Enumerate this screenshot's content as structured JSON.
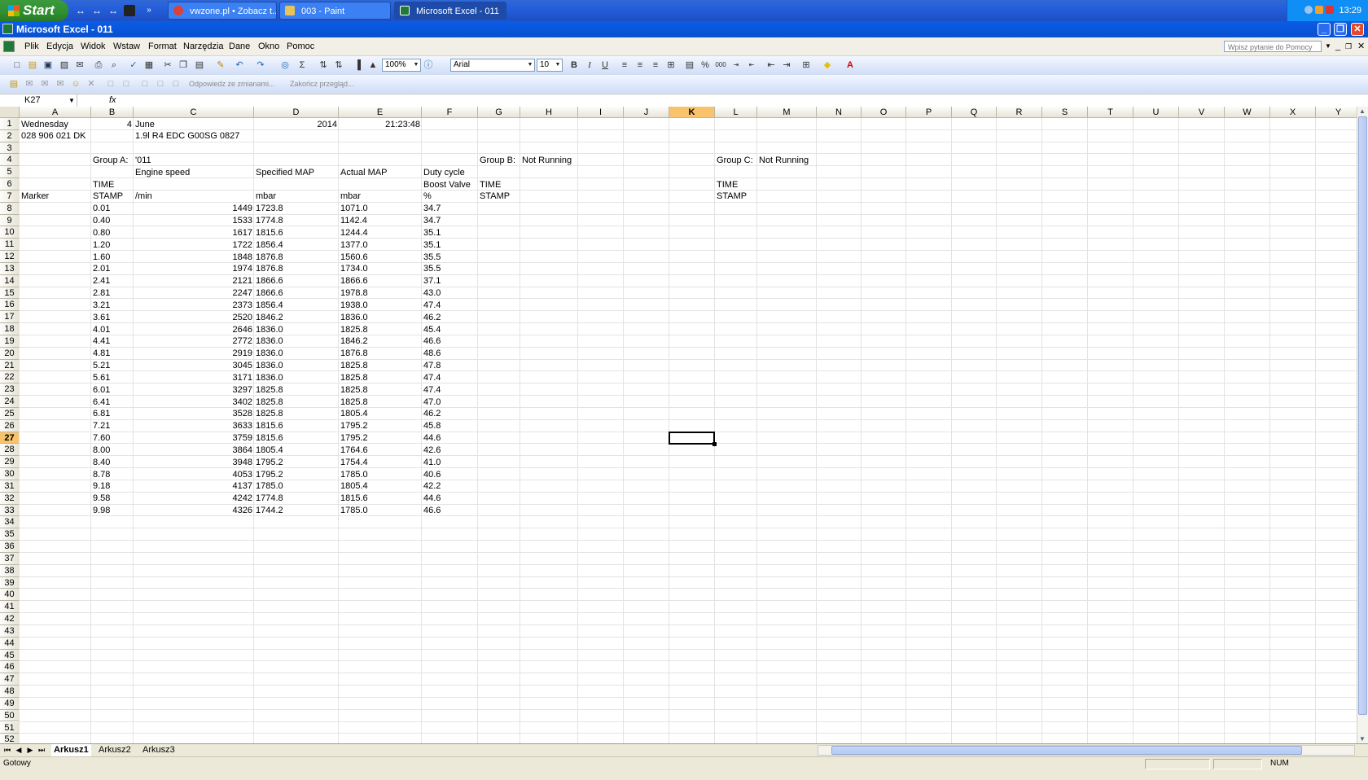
{
  "taskbar": {
    "start_label": "Start",
    "tasks": [
      {
        "label": "vwzone.pl • Zobacz t...",
        "active": false
      },
      {
        "label": "003 - Paint",
        "active": false
      },
      {
        "label": "Microsoft Excel - 011",
        "active": true
      }
    ],
    "clock": "13:29"
  },
  "window": {
    "title": "Microsoft Excel - 011"
  },
  "menu": {
    "items": [
      "Plik",
      "Edycja",
      "Widok",
      "Wstaw",
      "Format",
      "Narzędzia",
      "Dane",
      "Okno",
      "Pomoc"
    ],
    "help_placeholder": "Wpisz pytanie do Pomocy"
  },
  "toolbar": {
    "zoom": "100%",
    "font": "Arial",
    "font_size": "10",
    "bold": "B",
    "italic": "I",
    "underline": "U",
    "review_reply": "Odpowiedz ze zmianami...",
    "review_end": "Zakończ przegląd..."
  },
  "formula_bar": {
    "name_box": "K27",
    "fx": "fx",
    "content": ""
  },
  "sheet": {
    "columns": [
      "A",
      "B",
      "C",
      "D",
      "E",
      "F",
      "G",
      "H",
      "I",
      "J",
      "K",
      "L",
      "M",
      "N",
      "O",
      "P",
      "Q",
      "R",
      "S",
      "T",
      "U",
      "V",
      "W",
      "X",
      "Y"
    ],
    "selected_cell": "K27",
    "row_count": 52,
    "header_cells": [
      {
        "ref": "A1",
        "text": "Wednesday"
      },
      {
        "ref": "B1",
        "text": "4",
        "align": "right"
      },
      {
        "ref": "C1",
        "text": "June"
      },
      {
        "ref": "D1",
        "text": "2014",
        "align": "right"
      },
      {
        "ref": "E1",
        "text": "21:23:48",
        "align": "right"
      },
      {
        "ref": "A2",
        "text": "028 906 021 DK"
      },
      {
        "ref": "C2",
        "text": "1.9l R4 EDC  G00SG  0827"
      },
      {
        "ref": "B4",
        "text": "Group A:"
      },
      {
        "ref": "C4",
        "text": "'011"
      },
      {
        "ref": "G4",
        "text": "Group B:"
      },
      {
        "ref": "H4",
        "text": "Not Running"
      },
      {
        "ref": "L4",
        "text": "Group C:"
      },
      {
        "ref": "M4",
        "text": "Not Running"
      },
      {
        "ref": "C5",
        "text": "Engine speed"
      },
      {
        "ref": "D5",
        "text": "Specified MAP"
      },
      {
        "ref": "E5",
        "text": "Actual MAP"
      },
      {
        "ref": "F5",
        "text": "Duty cycle"
      },
      {
        "ref": "B6",
        "text": "TIME"
      },
      {
        "ref": "F6",
        "text": "Boost Valve"
      },
      {
        "ref": "G6",
        "text": "TIME"
      },
      {
        "ref": "L6",
        "text": "TIME"
      },
      {
        "ref": "A7",
        "text": "Marker"
      },
      {
        "ref": "B7",
        "text": "STAMP"
      },
      {
        "ref": "C7",
        "text": " /min"
      },
      {
        "ref": "D7",
        "text": " mbar"
      },
      {
        "ref": "E7",
        "text": " mbar"
      },
      {
        "ref": "F7",
        "text": " %"
      },
      {
        "ref": "G7",
        "text": "STAMP"
      },
      {
        "ref": "L7",
        "text": "STAMP"
      }
    ],
    "data_rows": [
      [
        "0.01",
        "1449",
        "1723.8",
        "1071.0",
        "34.7"
      ],
      [
        "0.40",
        "1533",
        "1774.8",
        "1142.4",
        "34.7"
      ],
      [
        "0.80",
        "1617",
        "1815.6",
        "1244.4",
        "35.1"
      ],
      [
        "1.20",
        "1722",
        "1856.4",
        "1377.0",
        "35.1"
      ],
      [
        "1.60",
        "1848",
        "1876.8",
        "1560.6",
        "35.5"
      ],
      [
        "2.01",
        "1974",
        "1876.8",
        "1734.0",
        "35.5"
      ],
      [
        "2.41",
        "2121",
        "1866.6",
        "1866.6",
        "37.1"
      ],
      [
        "2.81",
        "2247",
        "1866.6",
        "1978.8",
        "43.0"
      ],
      [
        "3.21",
        "2373",
        "1856.4",
        "1938.0",
        "47.4"
      ],
      [
        "3.61",
        "2520",
        "1846.2",
        "1836.0",
        "46.2"
      ],
      [
        "4.01",
        "2646",
        "1836.0",
        "1825.8",
        "45.4"
      ],
      [
        "4.41",
        "2772",
        "1836.0",
        "1846.2",
        "46.6"
      ],
      [
        "4.81",
        "2919",
        "1836.0",
        "1876.8",
        "48.6"
      ],
      [
        "5.21",
        "3045",
        "1836.0",
        "1825.8",
        "47.8"
      ],
      [
        "5.61",
        "3171",
        "1836.0",
        "1825.8",
        "47.4"
      ],
      [
        "6.01",
        "3297",
        "1825.8",
        "1825.8",
        "47.4"
      ],
      [
        "6.41",
        "3402",
        "1825.8",
        "1825.8",
        "47.0"
      ],
      [
        "6.81",
        "3528",
        "1825.8",
        "1805.4",
        "46.2"
      ],
      [
        "7.21",
        "3633",
        "1815.6",
        "1795.2",
        "45.8"
      ],
      [
        "7.60",
        "3759",
        "1815.6",
        "1795.2",
        "44.6"
      ],
      [
        "8.00",
        "3864",
        "1805.4",
        "1764.6",
        "42.6"
      ],
      [
        "8.40",
        "3948",
        "1795.2",
        "1754.4",
        "41.0"
      ],
      [
        "8.78",
        "4053",
        "1795.2",
        "1785.0",
        "40.6"
      ],
      [
        "9.18",
        "4137",
        "1785.0",
        "1805.4",
        "42.2"
      ],
      [
        "9.58",
        "4242",
        "1774.8",
        "1815.6",
        "44.6"
      ],
      [
        "9.98",
        "4326",
        "1744.2",
        "1785.0",
        "46.6"
      ]
    ]
  },
  "sheet_tabs": [
    {
      "label": "Arkusz1",
      "active": true
    },
    {
      "label": "Arkusz2",
      "active": false
    },
    {
      "label": "Arkusz3",
      "active": false
    }
  ],
  "status_bar": {
    "status": "Gotowy",
    "num": "NUM"
  }
}
